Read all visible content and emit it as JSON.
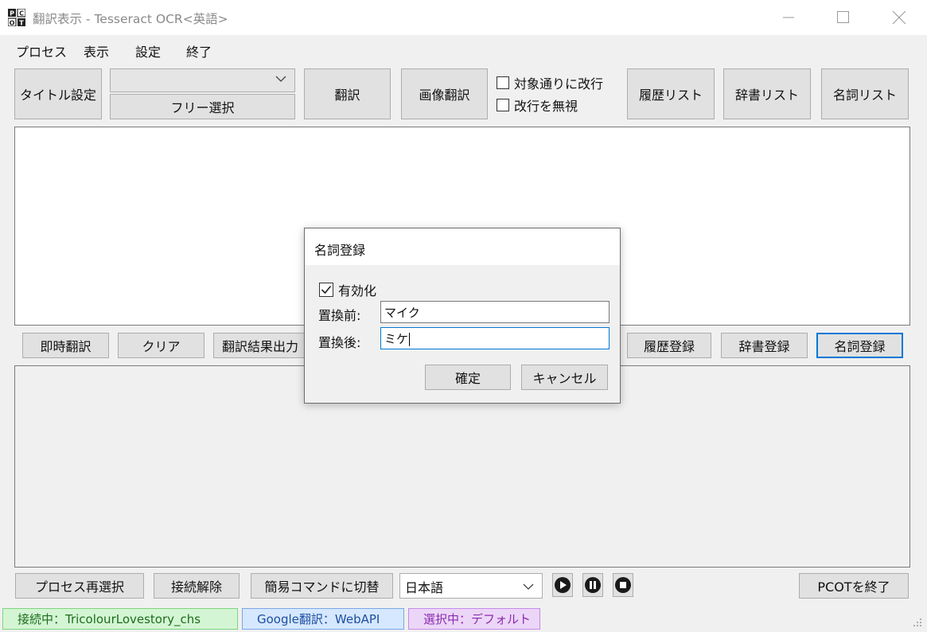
{
  "window": {
    "icon_glyph": "PCOT",
    "title": "翻訳表示 - Tesseract OCR<英語>",
    "controls": [
      "minimize-icon",
      "maximize-icon",
      "close-icon"
    ]
  },
  "menu": [
    "プロセス",
    "表示",
    "設定",
    "終了"
  ],
  "toolbar": {
    "title_setting": "タイトル設定",
    "window_combo_value": "",
    "free_select": "フリー選択",
    "translate": "翻訳",
    "image_translate": "画像翻訳",
    "opt_linebreak": "対象通りに改行",
    "opt_ignore_break": "改行を無視",
    "history_list": "履歴リスト",
    "dict_list": "辞書リスト",
    "noun_list": "名詞リスト"
  },
  "actions": {
    "instant": "即時翻訳",
    "clear": "クリア",
    "output": "翻訳結果出力",
    "history_reg": "履歴登録",
    "dict_reg": "辞書登録",
    "noun_reg": "名詞登録"
  },
  "bottom": {
    "reselect": "プロセス再選択",
    "disconnect": "接続解除",
    "simple_cmd": "簡易コマンドに切替",
    "language": "日本語",
    "media_icons": [
      "play-icon",
      "pause-icon",
      "stop-icon"
    ],
    "quit": "PCOTを終了"
  },
  "status": {
    "connection": "接続中：TricolourLovestory_chs",
    "engine": "Google翻訳：WebAPI",
    "selection": "選択中：デフォルト",
    "colors": {
      "connection_bg": "#d4f5d4",
      "connection_border": "#7fd27f",
      "connection_text": "#1c6d1c",
      "engine_bg": "#d6e8ff",
      "engine_border": "#7aa7e6",
      "engine_text": "#1d4fa0",
      "selection_bg": "#ecd6f7",
      "selection_border": "#c48ce6",
      "selection_text": "#8a2ab0"
    }
  },
  "dialog": {
    "title": "名詞登録",
    "enable_label": "有効化",
    "enabled": true,
    "before_label": "置換前:",
    "before_value": "マイク",
    "after_label": "置換後:",
    "after_value": "ミケ",
    "ok": "確定",
    "cancel": "キャンセル"
  }
}
